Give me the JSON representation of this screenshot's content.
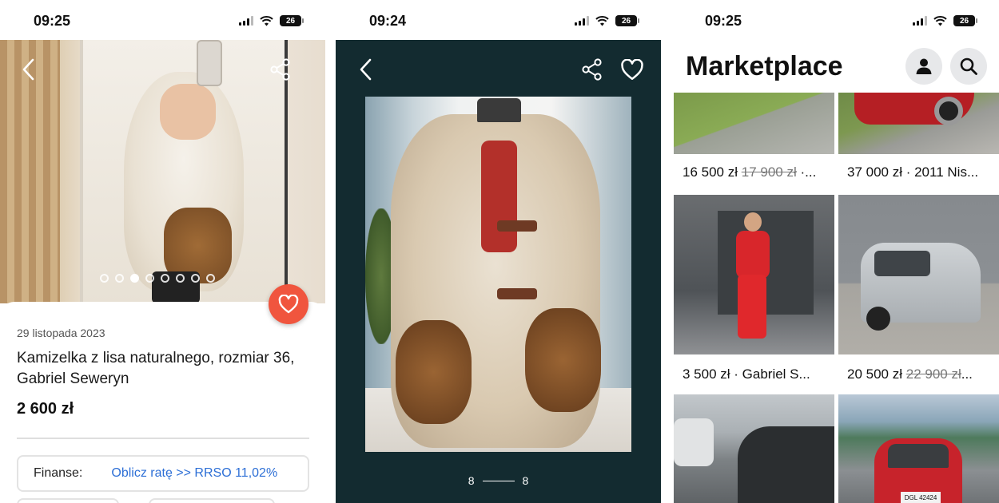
{
  "panel1": {
    "status": {
      "time": "09:25",
      "battery": "26"
    },
    "listing": {
      "date": "29 listopada 2023",
      "title": "Kamizelka z lisa naturalnego, rozmiar 36, Gabriel Seweryn",
      "price": "2 600 zł",
      "finance_label": "Finanse:",
      "finance_link": "Oblicz ratę >> RRSO 11,02%"
    },
    "carousel": {
      "count": 8,
      "active_index": 3
    },
    "icons": {
      "back": "chevron-left-icon",
      "share": "share-icon",
      "favorite": "heart-icon"
    },
    "accent_color": "#f0553e"
  },
  "panel2": {
    "status": {
      "time": "09:24",
      "battery": "26"
    },
    "counter": {
      "current": "8",
      "total": "8"
    },
    "icons": {
      "back": "chevron-left-icon",
      "share": "share-icon",
      "favorite": "heart-icon"
    },
    "background_color": "#132b30"
  },
  "panel3": {
    "status": {
      "time": "09:25",
      "battery": "26"
    },
    "title": "Marketplace",
    "icons": {
      "account": "user-icon",
      "search": "search-icon"
    },
    "tiles": [
      {
        "price": "16 500 zł",
        "old_price": "17 900 zł",
        "rest": " ·..."
      },
      {
        "price": "37 000 zł",
        "old_price": "",
        "rest": " · 2011 Nis..."
      },
      {
        "price": "3 500 zł",
        "old_price": "",
        "rest": " · Gabriel S..."
      },
      {
        "price": "20 500 zł",
        "old_price": "22 900 zł",
        "rest": "..."
      },
      {
        "plate": ""
      },
      {
        "plate": "DGL 42424"
      }
    ]
  }
}
